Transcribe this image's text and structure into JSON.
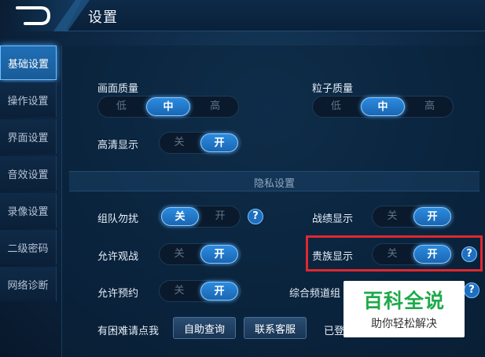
{
  "header": {
    "title": "设置"
  },
  "sidebar": {
    "tabs": [
      {
        "label": "基础设置",
        "active": true
      },
      {
        "label": "操作设置"
      },
      {
        "label": "界面设置"
      },
      {
        "label": "音效设置"
      },
      {
        "label": "录像设置"
      },
      {
        "label": "二级密码"
      },
      {
        "label": "网络诊断"
      }
    ]
  },
  "settings": {
    "picture_quality": {
      "label": "画面质量",
      "options": [
        "低",
        "中",
        "高"
      ],
      "selected": "中"
    },
    "particle_quality": {
      "label": "粒子质量",
      "options": [
        "低",
        "中",
        "高"
      ],
      "selected": "中"
    },
    "hd_display": {
      "label": "高清显示",
      "options": [
        "关",
        "开"
      ],
      "selected": "开"
    }
  },
  "privacy": {
    "title": "隐私设置",
    "team_dnd": {
      "label": "组队勿扰",
      "options": [
        "关",
        "开"
      ],
      "selected": "关"
    },
    "record_display": {
      "label": "战绩显示",
      "options": [
        "关",
        "开"
      ],
      "selected": "开"
    },
    "allow_spectate": {
      "label": "允许观战",
      "options": [
        "关",
        "开"
      ],
      "selected": "开"
    },
    "noble_display": {
      "label": "贵族显示",
      "options": [
        "关",
        "开"
      ],
      "selected": "开"
    },
    "allow_booking": {
      "label": "允许预约",
      "options": [
        "关",
        "开"
      ],
      "selected": "开"
    },
    "channel_label": "综合频道组"
  },
  "footer": {
    "help_text": "有困难请点我",
    "self_help_button": "自助查询",
    "contact_button": "联系客服",
    "logged_in_text": "已登"
  },
  "watermark": {
    "title": "百科全说",
    "subtitle": "助你轻松解决",
    "title_color": "#1eaa4a"
  },
  "colors": {
    "selected": "#2c8bdf",
    "highlight_box": "#e0282e",
    "background": "#0e2946"
  }
}
